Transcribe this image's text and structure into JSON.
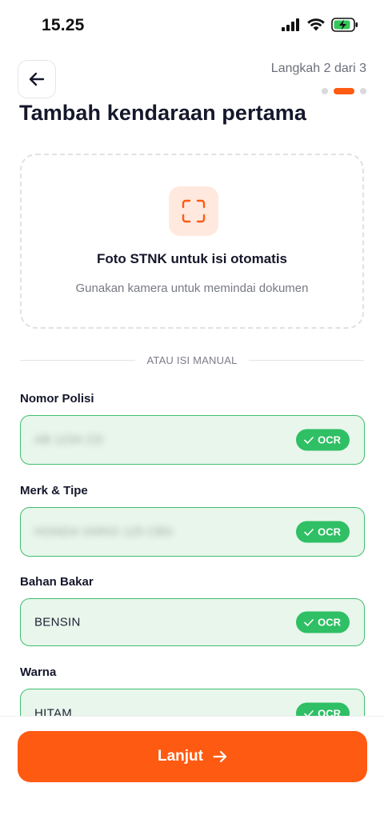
{
  "status_bar": {
    "time": "15.25",
    "icons": [
      "cellular-signal-icon",
      "wifi-icon",
      "battery-charging-icon"
    ]
  },
  "header": {
    "back_icon": "arrow-left-icon",
    "step_text": "Langkah 2 dari 3",
    "steps_total": 3,
    "step_current": 2,
    "title": "Tambah kendaraan pertama"
  },
  "scan_card": {
    "icon": "scan-frame-icon",
    "title": "Foto STNK untuk isi otomatis",
    "subtitle": "Gunakan kamera untuk memindai dokumen"
  },
  "divider": {
    "text": "ATAU ISI MANUAL"
  },
  "fields": [
    {
      "label": "Nomor Polisi",
      "value": "AB 1234 CD",
      "blurred": true,
      "badge": "OCR"
    },
    {
      "label": "Merk & Tipe",
      "value": "HONDA VARIO 125 CBS",
      "blurred": true,
      "badge": "OCR"
    },
    {
      "label": "Bahan Bakar",
      "value": "BENSIN",
      "blurred": false,
      "badge": "OCR"
    },
    {
      "label": "Warna",
      "value": "HITAM",
      "blurred": false,
      "badge": "OCR"
    }
  ],
  "footer": {
    "next_label": "Lanjut",
    "next_icon": "arrow-right-icon"
  },
  "colors": {
    "accent": "#ff5a12",
    "success": "#2fbf64",
    "field_bg": "#e8f6ec",
    "field_border": "#3fbf6e",
    "text_primary": "#15172b"
  }
}
